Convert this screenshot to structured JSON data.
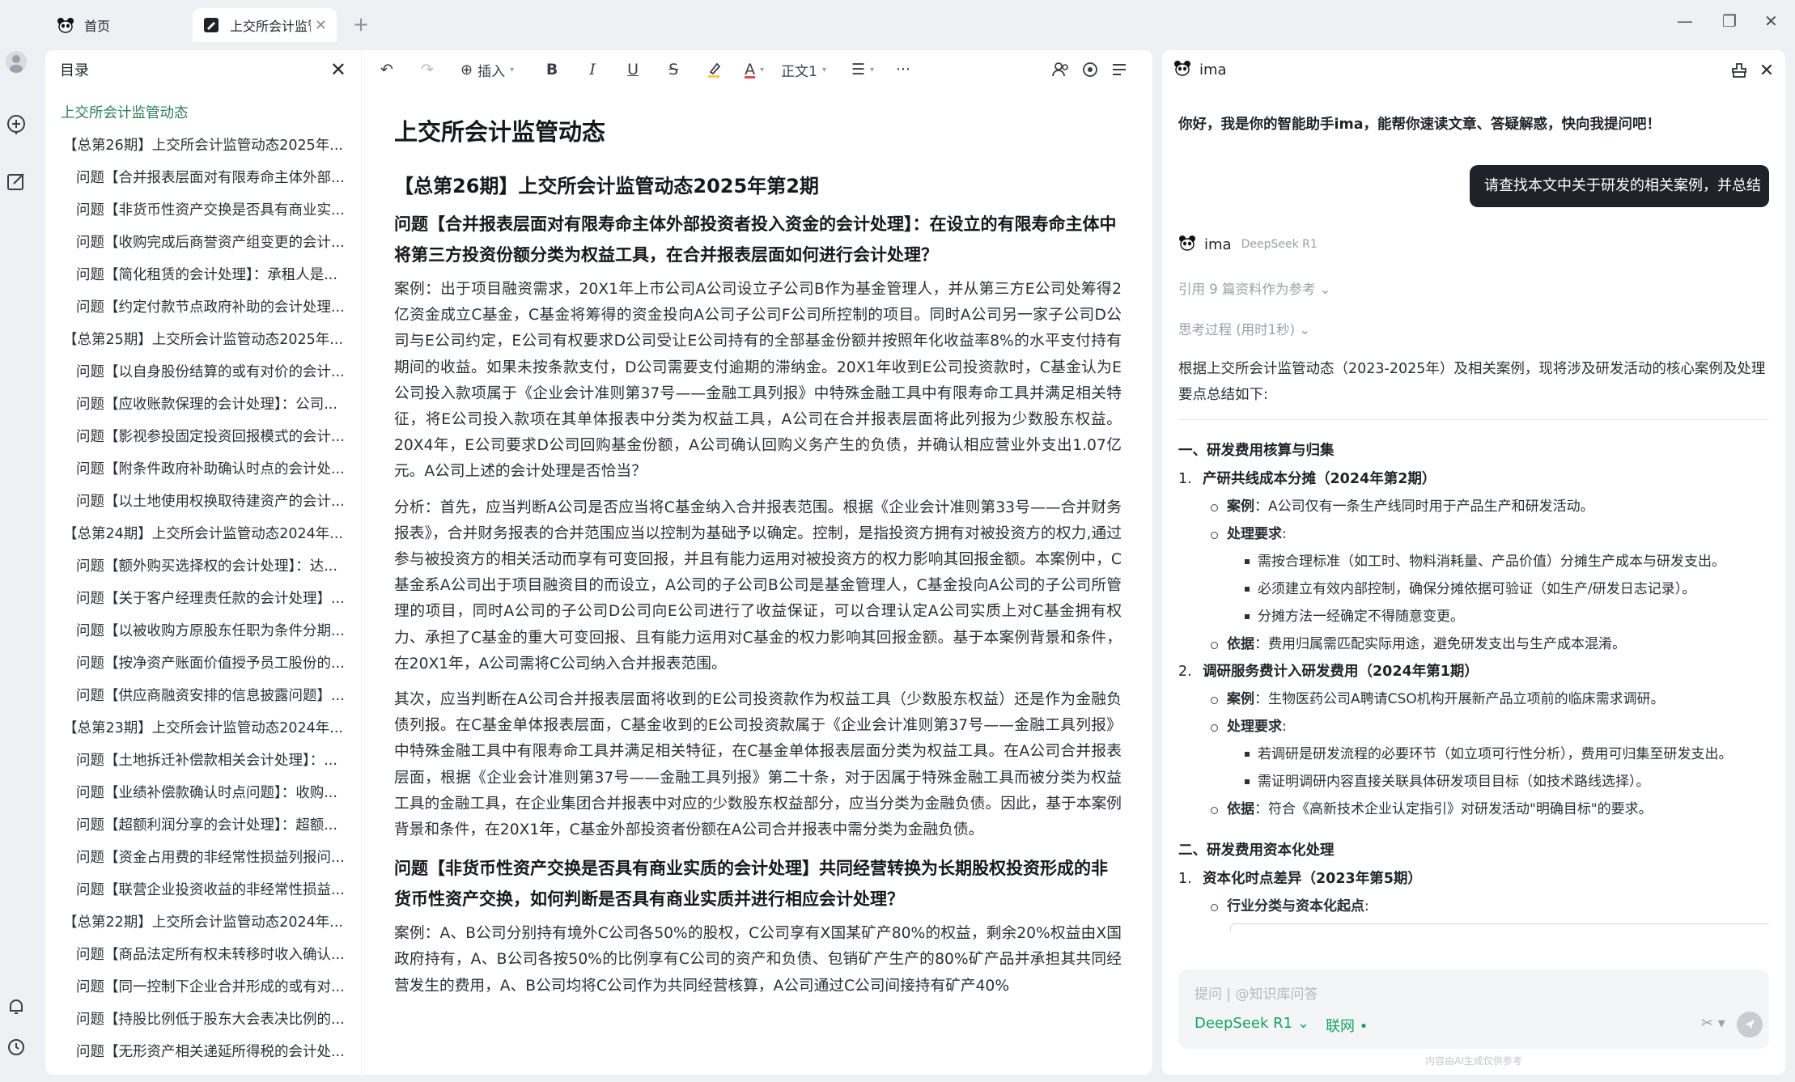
{
  "tabs": {
    "home_label": "首页",
    "doc_label": "上交所会计监管",
    "new_tab": "+"
  },
  "window_controls": {
    "minimize": "—",
    "restore": "❐",
    "close": "✕"
  },
  "toc": {
    "title": "目录",
    "items": [
      {
        "level": 0,
        "text": "上交所会计监管动态"
      },
      {
        "level": 1,
        "text": "【总第26期】上交所会计监管动态2025年..."
      },
      {
        "level": 2,
        "text": "问题【合并报表层面对有限寿命主体外部..."
      },
      {
        "level": 2,
        "text": "问题【非货币性资产交换是否具有商业实..."
      },
      {
        "level": 2,
        "text": "问题【收购完成后商誉资产组变更的会计..."
      },
      {
        "level": 2,
        "text": "问题【简化租赁的会计处理】：承租人是..."
      },
      {
        "level": 2,
        "text": "问题【约定付款节点政府补助的会计处理..."
      },
      {
        "level": 1,
        "text": "【总第25期】上交所会计监管动态2025年..."
      },
      {
        "level": 2,
        "text": "问题【以自身股份结算的或有对价的会计..."
      },
      {
        "level": 2,
        "text": "问题【应收账款保理的会计处理】：公司..."
      },
      {
        "level": 2,
        "text": "问题【影视参投固定投资回报模式的会计..."
      },
      {
        "level": 2,
        "text": "问题【附条件政府补助确认时点的会计处..."
      },
      {
        "level": 2,
        "text": "问题【以土地使用权换取待建资产的会计..."
      },
      {
        "level": 1,
        "text": "【总第24期】上交所会计监管动态2024年..."
      },
      {
        "level": 2,
        "text": "问题【额外购买选择权的会计处理】：达..."
      },
      {
        "level": 2,
        "text": "问题【关于客户经理责任款的会计处理】..."
      },
      {
        "level": 2,
        "text": "问题【以被收购方原股东任职为条件分期..."
      },
      {
        "level": 2,
        "text": "问题【按净资产账面价值授予员工股份的..."
      },
      {
        "level": 2,
        "text": "问题【供应商融资安排的信息披露问题】..."
      },
      {
        "level": 1,
        "text": "【总第23期】上交所会计监管动态2024年..."
      },
      {
        "level": 2,
        "text": "问题【土地拆迁补偿款相关会计处理】：..."
      },
      {
        "level": 2,
        "text": "问题【业绩补偿款确认时点问题】：收购..."
      },
      {
        "level": 2,
        "text": "问题【超额利润分享的会计处理】：超额..."
      },
      {
        "level": 2,
        "text": "问题【资金占用费的非经常性损益列报问..."
      },
      {
        "level": 2,
        "text": "问题【联营企业投资收益的非经常性损益..."
      },
      {
        "level": 1,
        "text": "【总第22期】上交所会计监管动态2024年..."
      },
      {
        "level": 2,
        "text": "问题【商品法定所有权未转移时收入确认..."
      },
      {
        "level": 2,
        "text": "问题【同一控制下企业合并形成的或有对..."
      },
      {
        "level": 2,
        "text": "问题【持股比例低于股东大会表决比例的..."
      },
      {
        "level": 2,
        "text": "问题【无形资产相关递延所得税的会计处..."
      }
    ]
  },
  "toolbar": {
    "undo": "↶",
    "redo": "↷",
    "insert_label": "插入",
    "bold": "B",
    "italic": "I",
    "underline": "U",
    "strike": "S",
    "font_color": "A",
    "style_label": "正文1",
    "align": "☰",
    "more": "···"
  },
  "doc": {
    "title": "上交所会计监管动态",
    "issue_heading": "【总第26期】上交所会计监管动态2025年第2期",
    "q1_heading": "问题【合并报表层面对有限寿命主体外部投资者投入资金的会计处理】：在设立的有限寿命主体中将第三方投资份额分类为权益工具，在合并报表层面如何进行会计处理？",
    "p1": "案例：出于项目融资需求，20X1年上市公司A公司设立子公司B作为基金管理人，并从第三方E公司处筹得2亿资金成立C基金，C基金将筹得的资金投向A公司子公司F公司所控制的项目。同时A公司另一家子公司D公司与E公司约定，E公司有权要求D公司受让E公司持有的全部基金份额并按照年化收益率8%的水平支付持有期间的收益。如果未按条款支付，D公司需要支付逾期的滞纳金。20X1年收到E公司投资款时，C基金认为E公司投入款项属于《企业会计准则第37号——金融工具列报》中特殊金融工具中有限寿命工具并满足相关特征，将E公司投入款项在其单体报表中分类为权益工具，A公司在合并报表层面将此列报为少数股东权益。20X4年，E公司要求D公司回购基金份额，A公司确认回购义务产生的负债，并确认相应营业外支出1.07亿元。A公司上述的会计处理是否恰当？",
    "p2": "分析：首先，应当判断A公司是否应当将C基金纳入合并报表范围。根据《企业会计准则第33号——合并财务报表》，合并财务报表的合并范围应当以控制为基础予以确定。控制，是指投资方拥有对被投资方的权力,通过参与被投资方的相关活动而享有可变回报，并且有能力运用对被投资方的权力影响其回报金额。本案例中，C基金系A公司出于项目融资目的而设立，A公司的子公司B公司是基金管理人，C基金投向A公司的子公司所管理的项目，同时A公司的子公司D公司向E公司进行了收益保证，可以合理认定A公司实质上对C基金拥有权力、承担了C基金的重大可变回报、且有能力运用对C基金的权力影响其回报金额。基于本案例背景和条件，在20X1年，A公司需将C公司纳入合并报表范围。",
    "p3": "其次，应当判断在A公司合并报表层面将收到的E公司投资款作为权益工具（少数股东权益）还是作为金融负债列报。在C基金单体报表层面，C基金收到的E公司投资款属于《企业会计准则第37号——金融工具列报》中特殊金融工具中有限寿命工具并满足相关特征，在C基金单体报表层面分类为权益工具。在A公司合并报表层面，根据《企业会计准则第37号——金融工具列报》第二十条，对于因属于特殊金融工具而被分类为权益工具的金融工具，在企业集团合并报表中对应的少数股东权益部分，应当分类为金融负债。因此，基于本案例背景和条件，在20X1年，C基金外部投资者份额在A公司合并报表中需分类为金融负债。",
    "q2_heading": "问题【非货币性资产交换是否具有商业实质的会计处理】共同经营转换为长期股权投资形成的非货币性资产交换，如何判断是否具有商业实质并进行相应会计处理？",
    "p4": "案例：A、B公司分别持有境外C公司各50%的股权，C公司享有X国某矿产80%的权益，剩余20%权益由X国政府持有，A、B公司各按50%的比例享有C公司的资产和负债、包销矿产生产的80%矿产品并承担其共同经营发生的费用，A、B公司均将C公司作为共同经营核算，A公司通过C公司间接持有矿产40%"
  },
  "ima": {
    "title": "ima",
    "greeting": "你好，我是你的智能助手ima，能帮你速读文章、答疑解惑，快向我提问吧！",
    "user_message": "请查找本文中关于研发的相关案例，并总结",
    "bot_name": "ima",
    "model_tag": "DeepSeek R1",
    "refs": "引用 9 篇资料作为参考 ⌄",
    "thinking": "思考过程 (用时1秒) ⌄",
    "lead": "根据上交所会计监管动态（2023-2025年）及相关案例，现将涉及研发活动的核心案例及处理要点总结如下:",
    "sec1": "一、研发费用核算与归集",
    "item1_num": "1.",
    "item1_title": "产研共线成本分摊（2024年第2期）",
    "i1_case_k": "案例",
    "i1_case_v": "：A公司仅有一条生产线同时用于产品生产和研发活动。",
    "i1_req_k": "处理要求",
    "i1_req_colon": ":",
    "i1_r1": "需按合理标准（如工时、物料消耗量、产品价值）分摊生产成本与研发支出。",
    "i1_r2": "必须建立有效内部控制，确保分摊依据可验证（如生产/研发日志记录）。",
    "i1_r3": "分摊方法一经确定不得随意变更。",
    "i1_basis_k": "依据",
    "i1_basis_v": "：费用归属需匹配实际用途，避免研发支出与生产成本混淆。",
    "item2_num": "2.",
    "item2_title": "调研服务费计入研发费用（2024年第1期）",
    "i2_case_k": "案例",
    "i2_case_v": "：生物医药公司A聘请CSO机构开展新产品立项前的临床需求调研。",
    "i2_req_k": "处理要求",
    "i2_req_colon": ":",
    "i2_r1": "若调研是研发流程的必要环节（如立项可行性分析），费用可归集至研发支出。",
    "i2_r2": "需证明调研内容直接关联具体研发项目目标（如技术路线选择）。",
    "i2_basis_k": "依据",
    "i2_basis_v": "：符合《高新技术企业认定指引》对研发活动\"明确目标\"的要求。",
    "sec2": "二、研发费用资本化处理",
    "item3_num": "1.",
    "item3_title": "资本化时点差异（2023年第5期）",
    "i3_k": "行业分类与资本化起点",
    "i3_colon": ":",
    "input_placeholder": "提问 | @知识库问答",
    "input_model": "DeepSeek R1 ⌄",
    "input_net": "联网 •",
    "input_scissors": "✂ ▾",
    "footnote": "内容由AI生成仅供参考"
  },
  "colors": {
    "accent_green": "#16a35f",
    "toc_active": "#2e7d5b",
    "bubble_dark": "#1f2329"
  }
}
